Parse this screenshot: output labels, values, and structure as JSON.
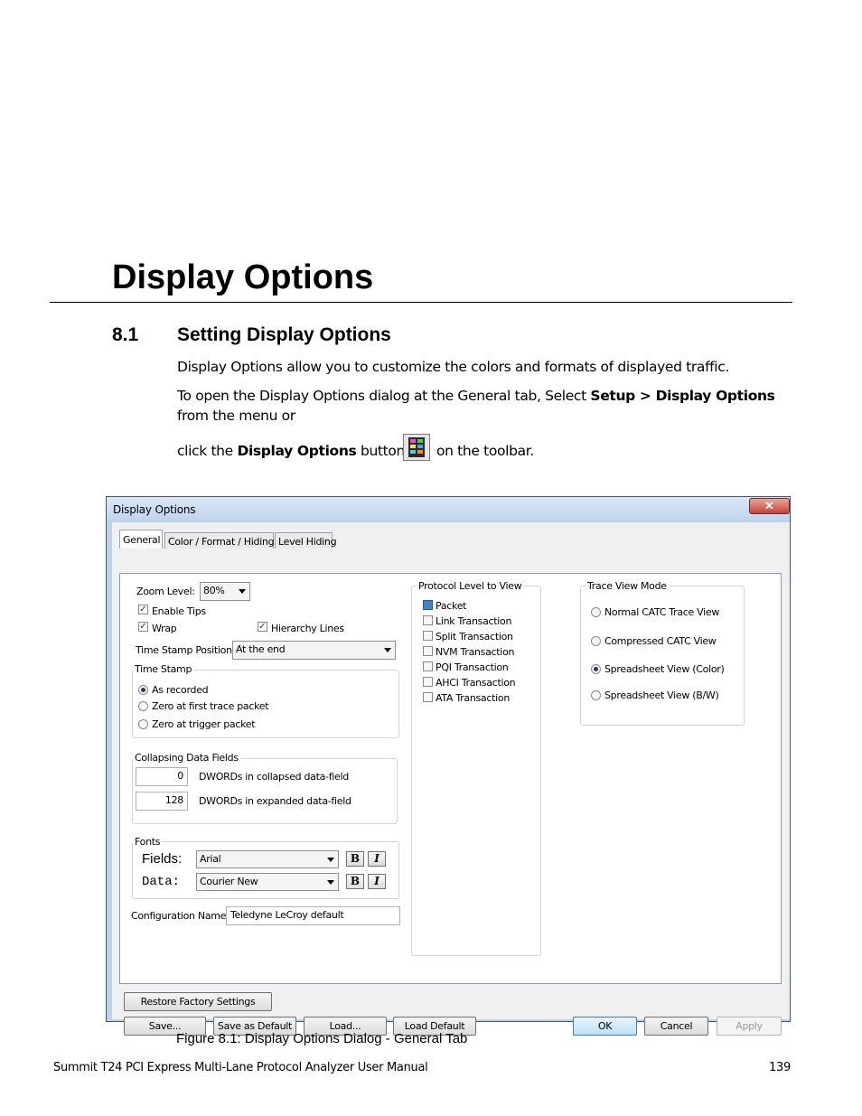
{
  "chapter": {
    "title": "Display Options"
  },
  "section": {
    "number": "8.1",
    "title": "Setting Display Options"
  },
  "paragraphs": {
    "p1": "Display Options allow you to customize the colors and formats of displayed traffic.",
    "p2_pre": "To open the Display Options dialog at the General tab, Select ",
    "p2_bold": "Setup > Display Options",
    "p2_post": "from the menu or",
    "p3_pre": "click the ",
    "p3_bold": "Display Options",
    "p3_mid": " button",
    "p3_post": "on the toolbar."
  },
  "toolbar_icon": "display-options-icon",
  "dialog": {
    "title": "Display Options",
    "close_glyph": "✕",
    "tabs": [
      {
        "label": "General",
        "active": true
      },
      {
        "label": "Color / Format / Hiding",
        "active": false
      },
      {
        "label": "Level Hiding",
        "active": false
      }
    ],
    "zoom": {
      "label": "Zoom Level:",
      "value": "80%"
    },
    "enable_tips": {
      "label": "Enable Tips",
      "checked": true
    },
    "wrap": {
      "label": "Wrap",
      "checked": true
    },
    "hierarchy_lines": {
      "label": "Hierarchy Lines",
      "checked": true
    },
    "timestamp_position": {
      "label": "Time Stamp Position:",
      "value": "At the end"
    },
    "time_stamp": {
      "label": "Time Stamp",
      "options": [
        {
          "label": "As recorded",
          "selected": true
        },
        {
          "label": "Zero at first trace packet",
          "selected": false
        },
        {
          "label": "Zero at trigger packet",
          "selected": false
        }
      ]
    },
    "collapsing": {
      "label": "Collapsing Data Fields",
      "collapsed_value": "0",
      "collapsed_label": "DWORDs in collapsed data-field",
      "expanded_value": "128",
      "expanded_label": "DWORDs in expanded data-field"
    },
    "fonts": {
      "label": "Fonts",
      "fields_label": "Fields:",
      "fields_font": "Arial",
      "data_label": "Data:",
      "data_font": "Courier New",
      "bold_glyph": "B",
      "italic_glyph": "I"
    },
    "config_name": {
      "label": "Configuration Name:",
      "value": "Teledyne LeCroy default"
    },
    "protocol_level": {
      "label": "Protocol Level to View",
      "items": [
        {
          "label": "Packet",
          "checked": true
        },
        {
          "label": "Link Transaction",
          "checked": false
        },
        {
          "label": "Split Transaction",
          "checked": false
        },
        {
          "label": "NVM Transaction",
          "checked": false
        },
        {
          "label": "PQI Transaction",
          "checked": false
        },
        {
          "label": "AHCI Transaction",
          "checked": false
        },
        {
          "label": "ATA Transaction",
          "checked": false
        }
      ]
    },
    "trace_view_mode": {
      "label": "Trace View Mode",
      "options": [
        {
          "label": "Normal CATC Trace View",
          "selected": false
        },
        {
          "label": "Compressed CATC View",
          "selected": false
        },
        {
          "label": "Spreadsheet View (Color)",
          "selected": true
        },
        {
          "label": "Spreadsheet View (B/W)",
          "selected": false
        }
      ]
    },
    "buttons": {
      "restore": "Restore Factory Settings",
      "save": "Save...",
      "save_default": "Save as Default",
      "load": "Load...",
      "load_default": "Load Default",
      "ok": "OK",
      "cancel": "Cancel",
      "apply": "Apply"
    }
  },
  "caption": "Figure 8.1:  Display Options Dialog - General Tab",
  "footer": {
    "left": "Summit T24 PCI Express Multi-Lane Protocol Analyzer User Manual",
    "page": "139"
  }
}
